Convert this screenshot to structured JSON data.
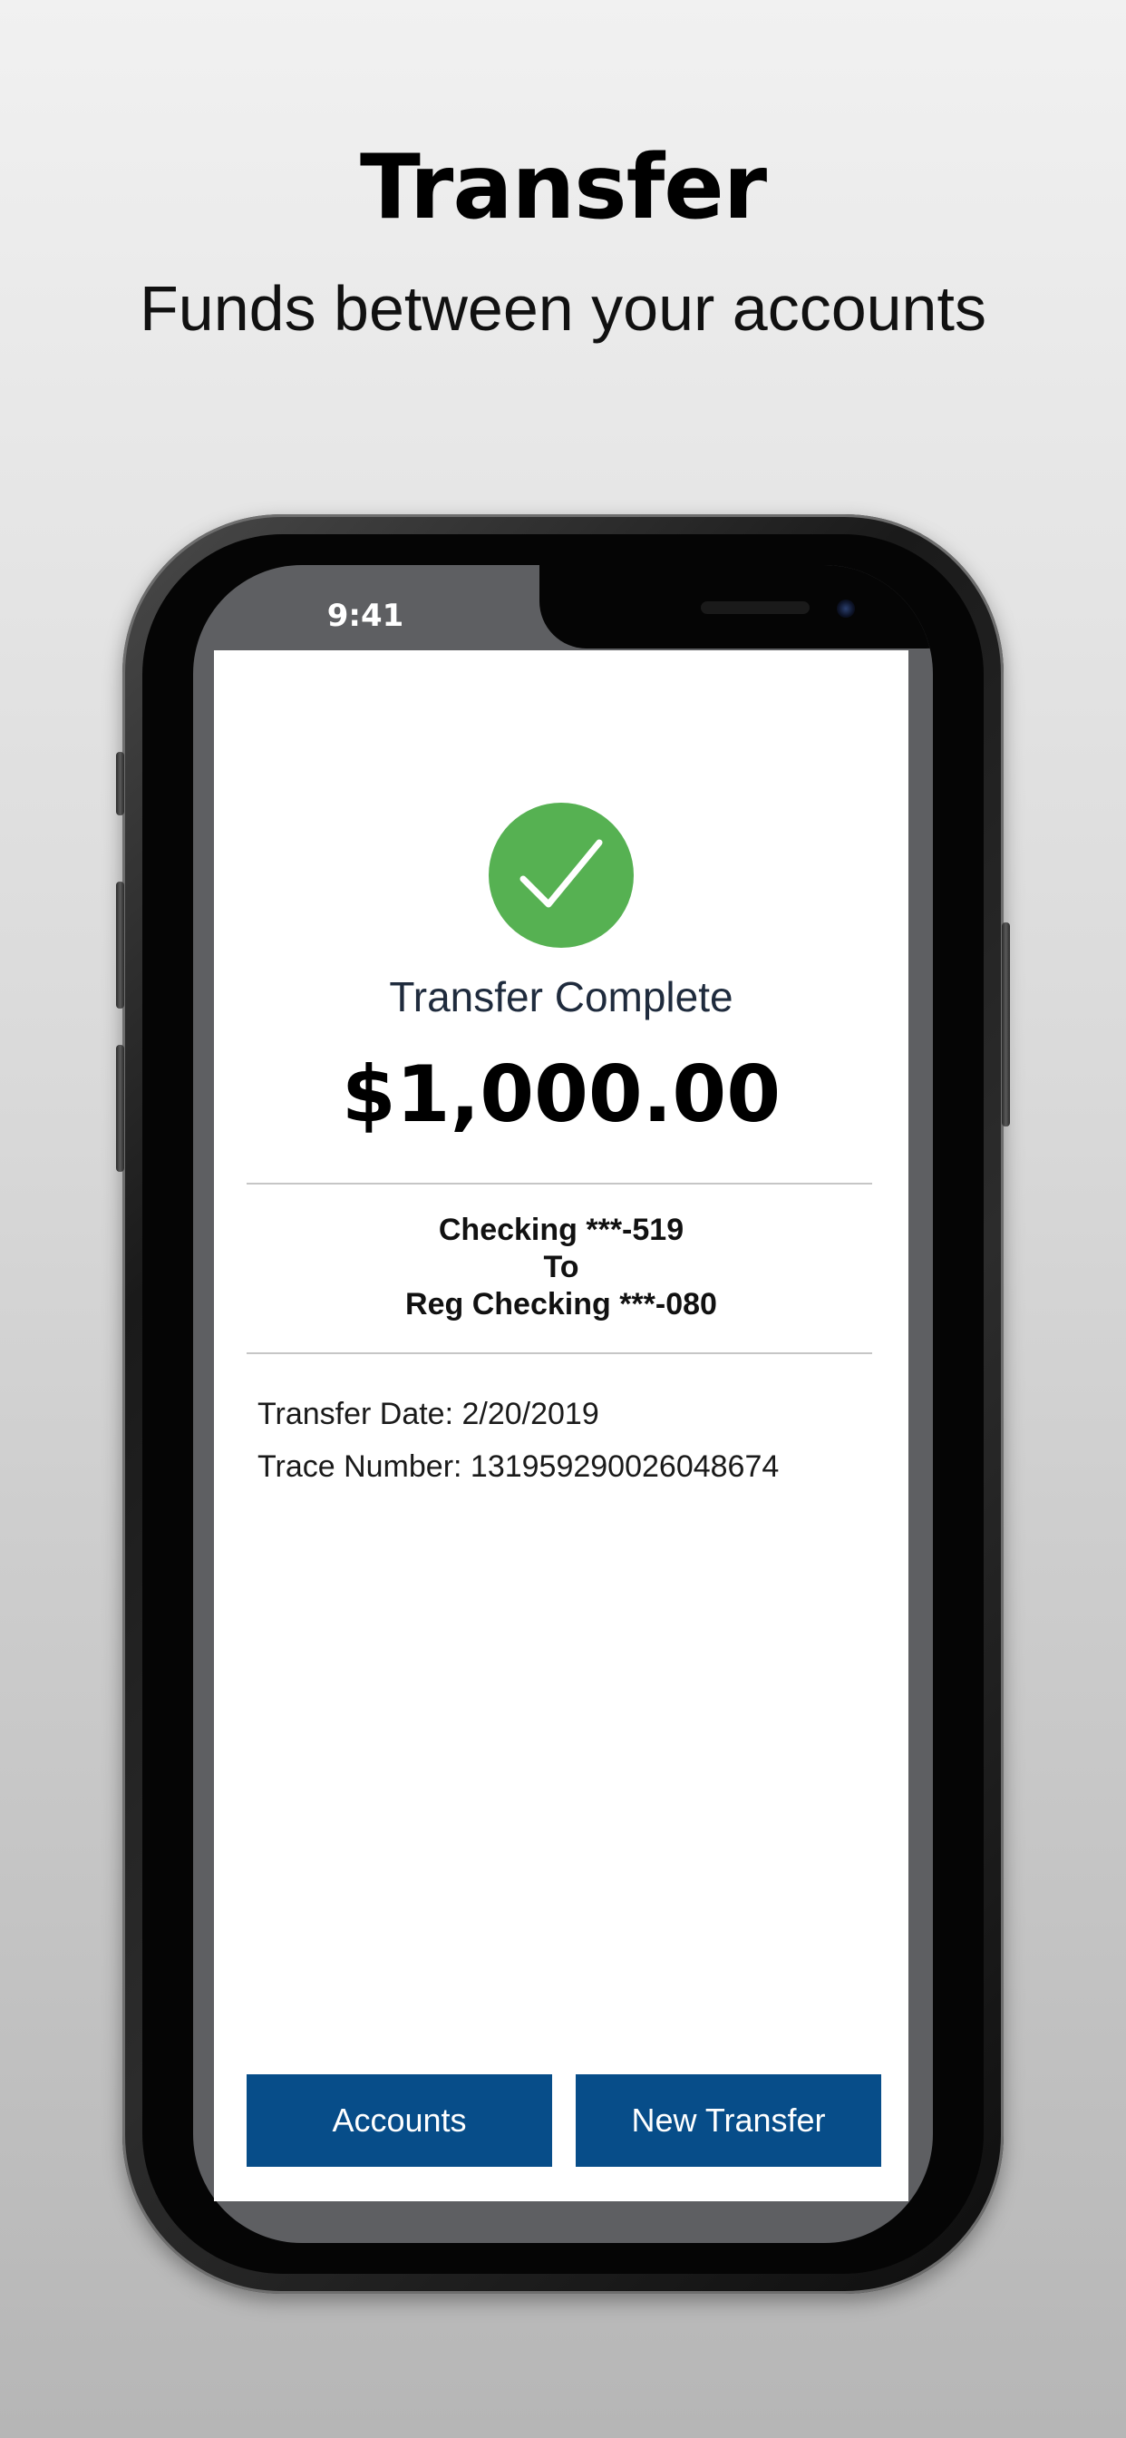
{
  "promo": {
    "headline": "Transfer",
    "subheadline": "Funds between your accounts"
  },
  "status_bar": {
    "time": "9:41",
    "icons": [
      "signal-icon",
      "wifi-icon",
      "battery-icon"
    ]
  },
  "transfer_result": {
    "status_icon": "checkmark-icon",
    "status_color": "#56b152",
    "title": "Transfer Complete",
    "amount": "$1,000.00",
    "from_account": "Checking ***-519",
    "to_label": "To",
    "to_account": "Reg Checking ***-080",
    "transfer_date": "Transfer Date: 2/20/2019",
    "trace_number": "Trace Number: 131959290026048674"
  },
  "actions": {
    "accounts_label": "Accounts",
    "new_transfer_label": "New Transfer",
    "button_color": "#074d89"
  }
}
